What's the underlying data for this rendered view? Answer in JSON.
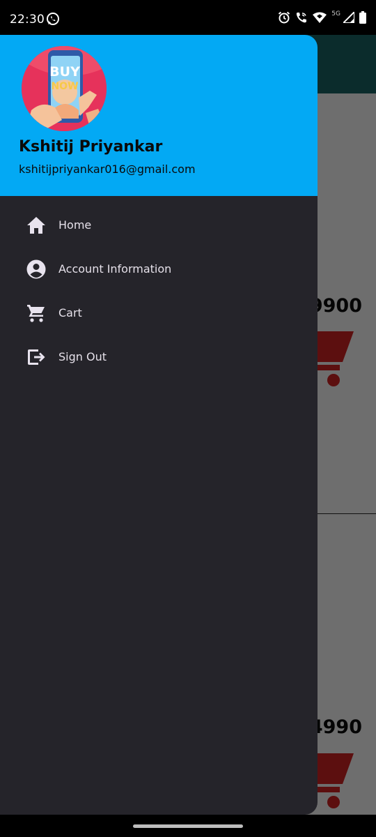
{
  "status_bar": {
    "time": "22:30",
    "left_icons": [
      "whatsapp-icon"
    ],
    "right_icons": [
      "alarm-icon",
      "wifi-call-icon",
      "wifi-icon",
      "signal-icon",
      "battery-icon"
    ],
    "network_label": "5G"
  },
  "background": {
    "price_1": "9900",
    "price_2": "4990",
    "appbar_color": "#0b2c2c",
    "cart_color": "#5c0f0f"
  },
  "drawer": {
    "header_color": "#03a9f4",
    "avatar_text_top": "BUY",
    "avatar_text_bottom": "NOW",
    "user_name": "Kshitij Priyankar",
    "user_email": "kshitijpriyankar016@gmail.com",
    "menu": [
      {
        "icon": "home-icon",
        "label": "Home"
      },
      {
        "icon": "account-circle-icon",
        "label": "Account Information"
      },
      {
        "icon": "cart-icon",
        "label": "Cart"
      },
      {
        "icon": "sign-out-icon",
        "label": "Sign Out"
      }
    ]
  }
}
